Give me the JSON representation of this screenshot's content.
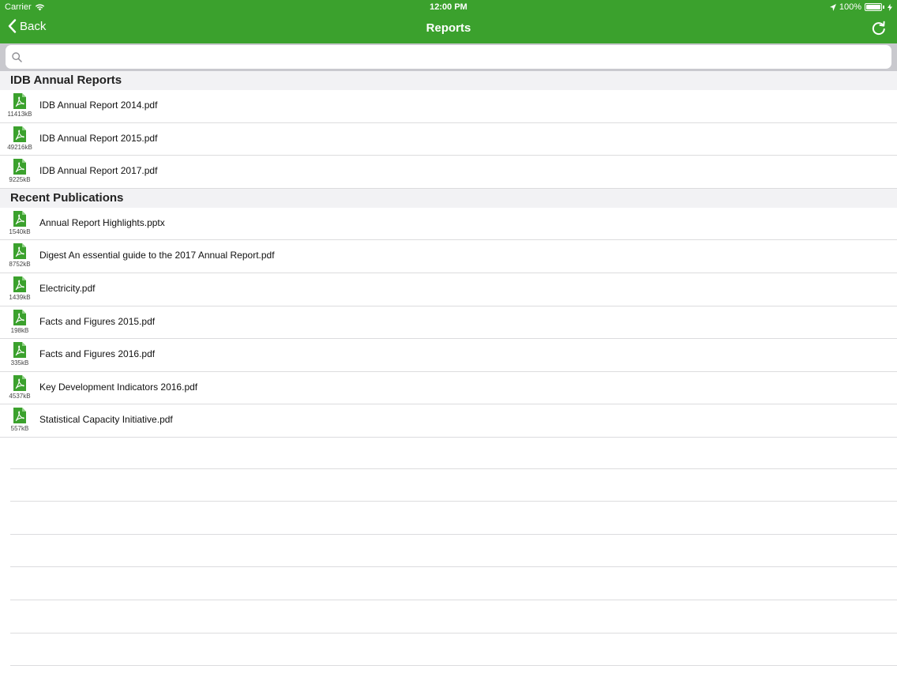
{
  "status_bar": {
    "carrier": "Carrier",
    "time": "12:00 PM",
    "battery": "100%"
  },
  "navbar": {
    "back_label": "Back",
    "title": "Reports",
    "accent_color": "#3ba12d"
  },
  "search": {
    "placeholder": "",
    "value": ""
  },
  "sections": [
    {
      "title": "IDB Annual Reports",
      "items": [
        {
          "name": "IDB Annual Report 2014.pdf",
          "size": "11413kB"
        },
        {
          "name": "IDB Annual Report 2015.pdf",
          "size": "49216kB"
        },
        {
          "name": "IDB Annual Report 2017.pdf",
          "size": "9225kB"
        }
      ]
    },
    {
      "title": "Recent Publications",
      "items": [
        {
          "name": "Annual Report Highlights.pptx",
          "size": "1540kB"
        },
        {
          "name": "Digest An essential  guide to the  2017 Annual Report.pdf",
          "size": "8752kB"
        },
        {
          "name": "Electricity.pdf",
          "size": "1439kB"
        },
        {
          "name": "Facts and Figures 2015.pdf",
          "size": "198kB"
        },
        {
          "name": "Facts and Figures 2016.pdf",
          "size": "335kB"
        },
        {
          "name": "Key Development Indicators 2016.pdf",
          "size": "4537kB"
        },
        {
          "name": "Statistical Capacity Initiative.pdf",
          "size": "557kB"
        }
      ]
    }
  ],
  "icons": {
    "file": "pdf-file-icon",
    "back": "chevron-left-icon",
    "refresh": "refresh-icon",
    "search": "search-icon"
  }
}
